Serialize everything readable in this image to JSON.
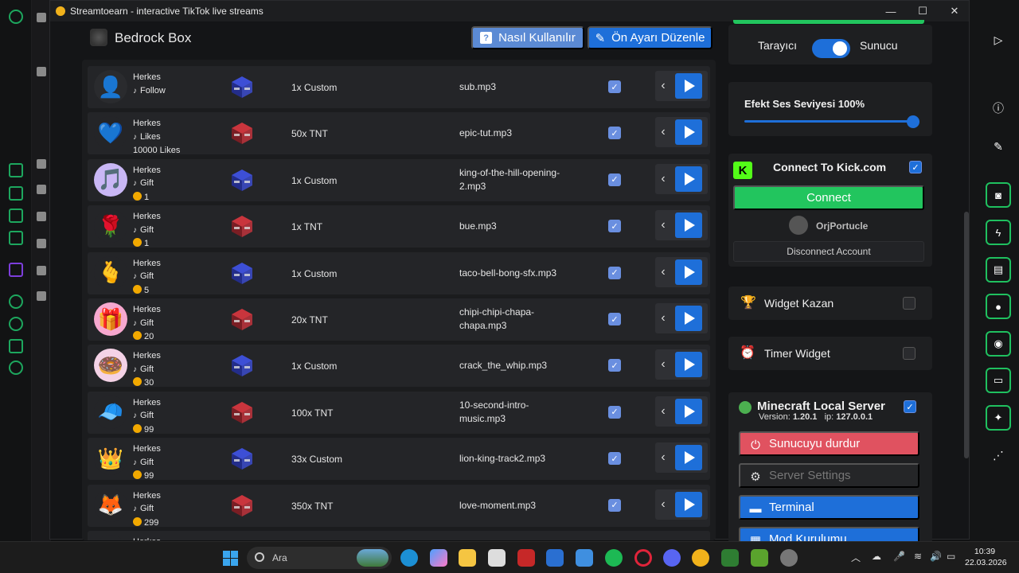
{
  "window": {
    "title": "Streamtoearn - interactive TikTok live streams",
    "minimize": "—",
    "maximize": "☐",
    "close": "✕"
  },
  "header": {
    "title": "Bedrock Box",
    "help_label": "Nasıl Kullanılır",
    "help_glyph": "?",
    "preset_label": "Ön Ayarı Düzenle",
    "preset_glyph": "✎"
  },
  "rows": [
    {
      "user": "Herkes",
      "event": "Follow",
      "extra": "",
      "coin": "",
      "block": "custom",
      "action": "1x Custom",
      "sound": [
        "sub.mp3"
      ],
      "avatar": "👤",
      "avatar_bg": "#2a2b2e"
    },
    {
      "user": "Herkes",
      "event": "Likes",
      "extra": "10000 Likes",
      "coin": "",
      "block": "tnt",
      "action": "50x TNT",
      "sound": [
        "epic-tut.mp3"
      ],
      "avatar": "💙",
      "avatar_bg": "#242528"
    },
    {
      "user": "Herkes",
      "event": "Gift",
      "extra": "",
      "coin": "1",
      "block": "custom",
      "action": "1x Custom",
      "sound": [
        "king-of-the-hill-opening-",
        "2.mp3"
      ],
      "avatar": "🎵",
      "avatar_bg": "#c9b7f5"
    },
    {
      "user": "Herkes",
      "event": "Gift",
      "extra": "",
      "coin": "1",
      "block": "tnt",
      "action": "1x TNT",
      "sound": [
        "bue.mp3"
      ],
      "avatar": "🌹",
      "avatar_bg": "#242528"
    },
    {
      "user": "Herkes",
      "event": "Gift",
      "extra": "",
      "coin": "5",
      "block": "custom",
      "action": "1x Custom",
      "sound": [
        "taco-bell-bong-sfx.mp3"
      ],
      "avatar": "🫰",
      "avatar_bg": "#242528"
    },
    {
      "user": "Herkes",
      "event": "Gift",
      "extra": "",
      "coin": "20",
      "block": "tnt",
      "action": "20x TNT",
      "sound": [
        "chipi-chipi-chapa-",
        "chapa.mp3"
      ],
      "avatar": "🎁",
      "avatar_bg": "#f7a8cf"
    },
    {
      "user": "Herkes",
      "event": "Gift",
      "extra": "",
      "coin": "30",
      "block": "custom",
      "action": "1x Custom",
      "sound": [
        "crack_the_whip.mp3"
      ],
      "avatar": "🍩",
      "avatar_bg": "#f4d2e6"
    },
    {
      "user": "Herkes",
      "event": "Gift",
      "extra": "",
      "coin": "99",
      "block": "tnt",
      "action": "100x TNT",
      "sound": [
        "10-second-intro-",
        "music.mp3"
      ],
      "avatar": "🧢",
      "avatar_bg": "#242528"
    },
    {
      "user": "Herkes",
      "event": "Gift",
      "extra": "",
      "coin": "99",
      "block": "custom",
      "action": "33x Custom",
      "sound": [
        "lion-king-track2.mp3"
      ],
      "avatar": "👑",
      "avatar_bg": "#242528"
    },
    {
      "user": "Herkes",
      "event": "Gift",
      "extra": "",
      "coin": "299",
      "block": "tnt",
      "action": "350x TNT",
      "sound": [
        "love-moment.mp3"
      ],
      "avatar": "🦊",
      "avatar_bg": "#242528"
    },
    {
      "user": "Herkes",
      "event": "",
      "extra": "",
      "coin": "",
      "block": "",
      "action": "",
      "sound": [
        ""
      ],
      "avatar": "",
      "avatar_bg": "#242528"
    }
  ],
  "side": {
    "mode_left": "Tarayıcı",
    "mode_right": "Sunucu",
    "volume_label": "Efekt Ses Seviyesi 100%",
    "volume_value": 100,
    "kick_title": "Connect To Kick.com",
    "kick_logo": "K",
    "connect_label": "Connect",
    "account_name": "OrjPortucle",
    "disconnect_label": "Disconnect Account",
    "widget_kazan": "Widget Kazan",
    "timer_widget": "Timer Widget",
    "mc_title": "Minecraft Local Server",
    "mc_version_label": "Version:",
    "mc_version": "1.20.1",
    "mc_ip_label": "ip:",
    "mc_ip": "127.0.0.1",
    "stop_label": "Sunucuyu durdur",
    "settings_label": "Server Settings",
    "terminal_label": "Terminal",
    "mod_label": "Mod Kurulumu"
  },
  "taskbar": {
    "search_placeholder": "Ara",
    "time": "10:39",
    "date": "22.03.2026"
  },
  "colors": {
    "accent": "#1e6fd9",
    "kick": "#53fc18",
    "connect": "#22c55e",
    "stop": "#e05260",
    "coin": "#f2a900"
  }
}
